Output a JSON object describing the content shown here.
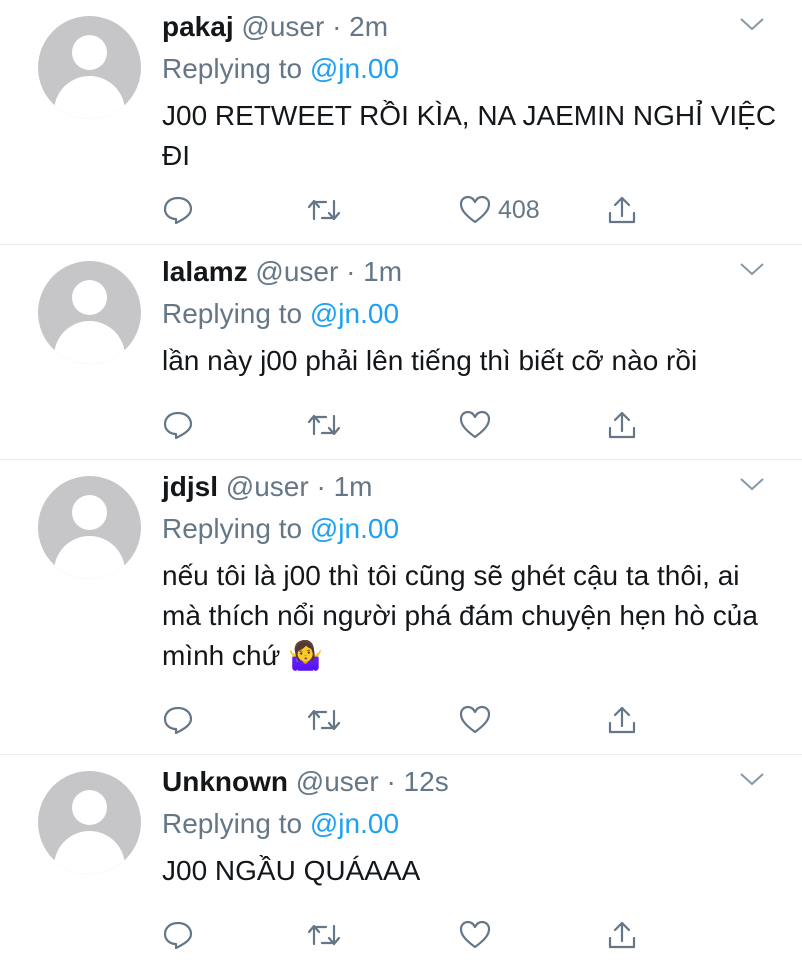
{
  "tweets": [
    {
      "name": "pakaj",
      "meta": "@user · 2m",
      "replying_prefix": "Replying to",
      "replying_handle": "@jn.00",
      "text": "J00 RETWEET RỒI KÌA, NA JAEMIN NGHỈ VIỆC ĐI",
      "like_count": "408"
    },
    {
      "name": "lalamz",
      "meta": "@user · 1m",
      "replying_prefix": "Replying to",
      "replying_handle": "@jn.00",
      "text": "lần này j00 phải lên tiếng thì biết cỡ nào rồi",
      "like_count": ""
    },
    {
      "name": "jdjsl",
      "meta": "@user · 1m",
      "replying_prefix": "Replying to",
      "replying_handle": "@jn.00",
      "text": "nếu tôi là j00 thì tôi cũng sẽ ghét cậu ta thôi, ai mà thích nổi người phá đám chuyện hẹn hò của mình chứ 🤷‍♀️",
      "like_count": ""
    },
    {
      "name": "Unknown",
      "meta": "@user · 12s",
      "replying_prefix": "Replying to",
      "replying_handle": "@jn.00",
      "text": "J00 NGẦU QUÁAAA",
      "like_count": ""
    }
  ],
  "icons": {
    "reply": "reply-icon",
    "retweet": "retweet-icon",
    "like": "heart-icon",
    "share": "share-icon",
    "more": "chevron-down-icon",
    "avatar": "default-avatar"
  },
  "colors": {
    "name": "#14171a",
    "meta": "#657786",
    "link": "#1da1f2",
    "avatar": "#c6c6c9",
    "divider": "#e6ecf0"
  }
}
